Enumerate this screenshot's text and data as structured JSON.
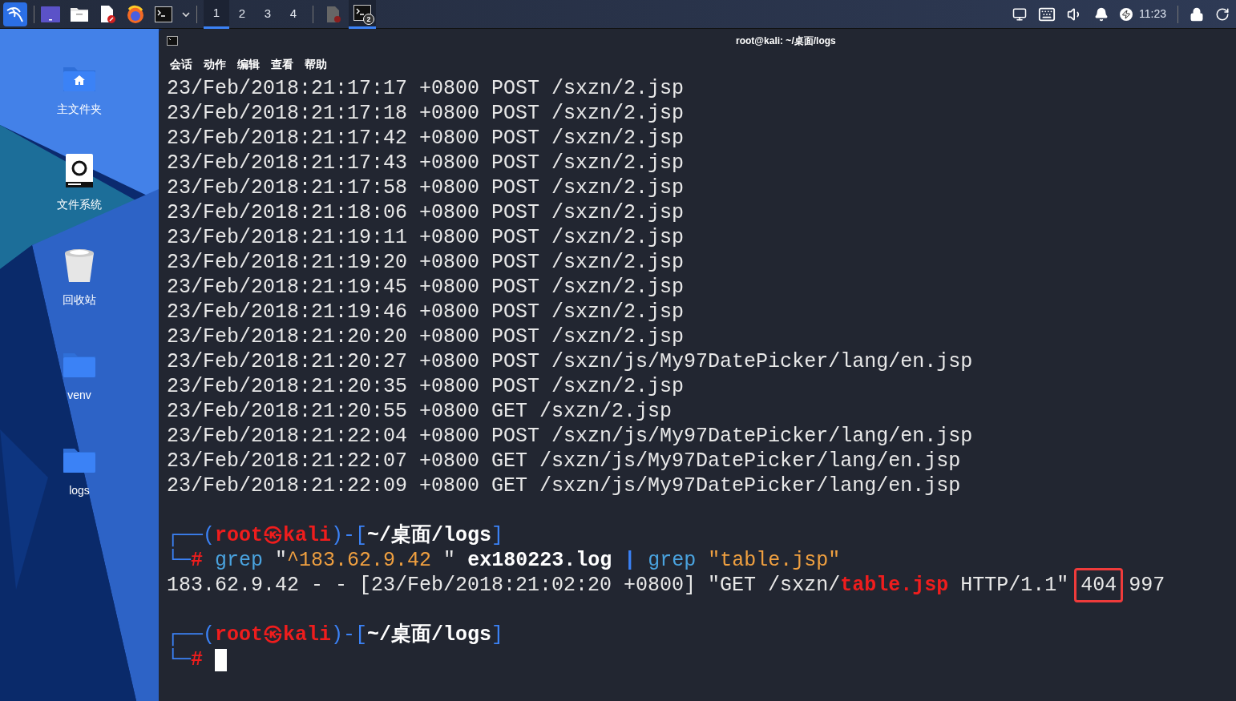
{
  "taskbar": {
    "workspaces": [
      {
        "label": "1",
        "selected": true
      },
      {
        "label": "2",
        "selected": false
      },
      {
        "label": "3",
        "selected": false
      },
      {
        "label": "4",
        "selected": false
      }
    ],
    "windows": [
      {
        "kind": "editor",
        "selected": false
      },
      {
        "kind": "terminal",
        "selected": true,
        "badge": "2"
      }
    ],
    "clock": "11:23"
  },
  "desktop": {
    "icons": [
      {
        "kind": "home",
        "label": "主文件夹"
      },
      {
        "kind": "drive",
        "label": "文件系统"
      },
      {
        "kind": "trash",
        "label": "回收站"
      },
      {
        "kind": "folder",
        "label": "venv"
      },
      {
        "kind": "folder",
        "label": "logs"
      }
    ]
  },
  "terminal": {
    "title": "root@kali: ~/桌面/logs",
    "menu": [
      "会话",
      "动作",
      "编辑",
      "查看",
      "帮助"
    ],
    "log_lines": [
      "23/Feb/2018:21:17:17 +0800 POST /sxzn/2.jsp",
      "23/Feb/2018:21:17:18 +0800 POST /sxzn/2.jsp",
      "23/Feb/2018:21:17:42 +0800 POST /sxzn/2.jsp",
      "23/Feb/2018:21:17:43 +0800 POST /sxzn/2.jsp",
      "23/Feb/2018:21:17:58 +0800 POST /sxzn/2.jsp",
      "23/Feb/2018:21:18:06 +0800 POST /sxzn/2.jsp",
      "23/Feb/2018:21:19:11 +0800 POST /sxzn/2.jsp",
      "23/Feb/2018:21:19:20 +0800 POST /sxzn/2.jsp",
      "23/Feb/2018:21:19:45 +0800 POST /sxzn/2.jsp",
      "23/Feb/2018:21:19:46 +0800 POST /sxzn/2.jsp",
      "23/Feb/2018:21:20:20 +0800 POST /sxzn/2.jsp",
      "23/Feb/2018:21:20:27 +0800 POST /sxzn/js/My97DatePicker/lang/en.jsp",
      "23/Feb/2018:21:20:35 +0800 POST /sxzn/2.jsp",
      "23/Feb/2018:21:20:55 +0800 GET /sxzn/2.jsp",
      "23/Feb/2018:21:22:04 +0800 POST /sxzn/js/My97DatePicker/lang/en.jsp",
      "23/Feb/2018:21:22:07 +0800 GET /sxzn/js/My97DatePicker/lang/en.jsp",
      "23/Feb/2018:21:22:09 +0800 GET /sxzn/js/My97DatePicker/lang/en.jsp"
    ],
    "blocks": [
      {
        "lines": [
          [
            {
              "kind": "frame",
              "text": "┌──("
            },
            {
              "kind": "user",
              "text": "root"
            },
            {
              "kind": "user",
              "text": "㉿"
            },
            {
              "kind": "user",
              "text": "kali"
            },
            {
              "kind": "frame",
              "text": ")-["
            },
            {
              "kind": "path",
              "text": "~/桌面/logs"
            },
            {
              "kind": "frame",
              "text": "]"
            }
          ],
          [
            {
              "kind": "frame",
              "text": "└─"
            },
            {
              "kind": "hash",
              "text": "#"
            },
            {
              "kind": "command",
              "text": " grep"
            },
            {
              "kind": "plain",
              "text": " \""
            },
            {
              "kind": "string",
              "text": "^183.62.9.42 "
            },
            {
              "kind": "plain",
              "text": "\""
            },
            {
              "kind": "bold",
              "text": " ex180223.log"
            },
            {
              "kind": "pipe",
              "text": " |"
            },
            {
              "kind": "command",
              "text": " grep"
            },
            {
              "kind": "string",
              "text": " \"table.jsp\""
            }
          ],
          [
            {
              "kind": "plain",
              "text": "183.62.9.42 - - [23/Feb/2018:21:02:20 +0800] \"GET /sxzn/"
            },
            {
              "kind": "match",
              "text": "table.jsp"
            },
            {
              "kind": "plain",
              "text": " HTTP/1.1\" "
            },
            {
              "kind": "boxed",
              "text": "404"
            },
            {
              "kind": "plain",
              "text": " 997"
            }
          ]
        ]
      },
      {
        "lines": [
          [
            {
              "kind": "frame",
              "text": "┌──("
            },
            {
              "kind": "user",
              "text": "root"
            },
            {
              "kind": "user",
              "text": "㉿"
            },
            {
              "kind": "user",
              "text": "kali"
            },
            {
              "kind": "frame",
              "text": ")-["
            },
            {
              "kind": "path",
              "text": "~/桌面/logs"
            },
            {
              "kind": "frame",
              "text": "]"
            }
          ],
          [
            {
              "kind": "frame",
              "text": "└─"
            },
            {
              "kind": "hash",
              "text": "#"
            },
            {
              "kind": "cursor"
            }
          ]
        ]
      }
    ]
  }
}
